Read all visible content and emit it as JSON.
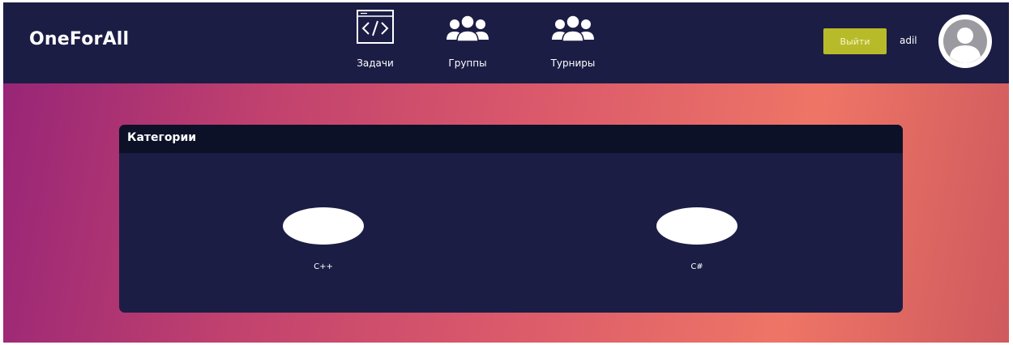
{
  "header": {
    "brand": "OneForAll",
    "nav": [
      {
        "label": "Задачи",
        "icon": "code-window-icon"
      },
      {
        "label": "Группы",
        "icon": "group-icon"
      },
      {
        "label": "Турниры",
        "icon": "group-icon"
      }
    ],
    "logout_label": "Выйти",
    "username": "adil",
    "avatar_icon": "user-avatar-icon"
  },
  "card": {
    "title": "Категории",
    "categories": [
      {
        "label": "C++"
      },
      {
        "label": "C#"
      }
    ]
  },
  "colors": {
    "navbar": "#1c1d45",
    "card_header": "#0c1128",
    "logout_button": "#b8bb29",
    "gradient": [
      "#982577",
      "#c0416e",
      "#d9586b",
      "#ee7566",
      "#cf5a5e"
    ]
  }
}
